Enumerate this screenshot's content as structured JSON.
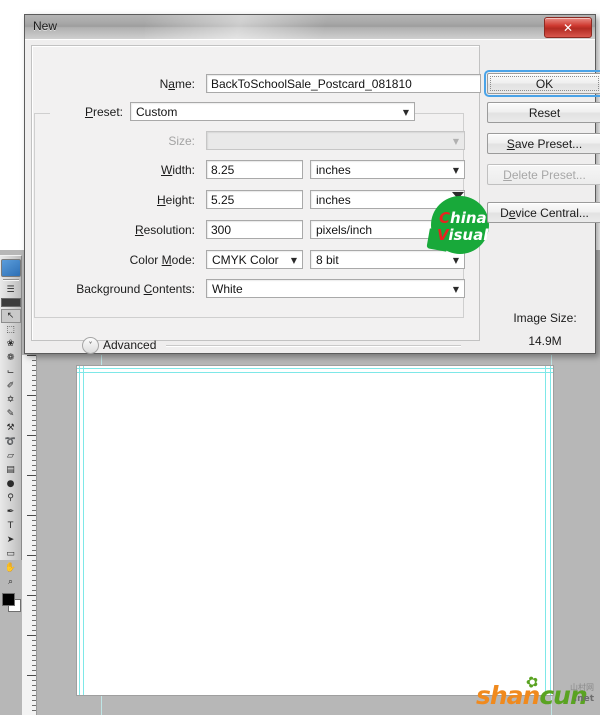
{
  "workspace": {
    "app": "Adobe Photoshop",
    "toolbar": {
      "tools": [
        {
          "name": "move-tool",
          "glyph": "↖"
        },
        {
          "name": "marquee-tool",
          "glyph": "⬚"
        },
        {
          "name": "lasso-tool",
          "glyph": "❀"
        },
        {
          "name": "quick-select-tool",
          "glyph": "❁"
        },
        {
          "name": "crop-tool",
          "glyph": "⌙"
        },
        {
          "name": "eyedropper-tool",
          "glyph": "✐"
        },
        {
          "name": "healing-brush-tool",
          "glyph": "✡"
        },
        {
          "name": "brush-tool",
          "glyph": "✎"
        },
        {
          "name": "clone-stamp-tool",
          "glyph": "⚒"
        },
        {
          "name": "history-brush-tool",
          "glyph": "➰"
        },
        {
          "name": "eraser-tool",
          "glyph": "▱"
        },
        {
          "name": "gradient-tool",
          "glyph": "▤"
        },
        {
          "name": "blur-tool",
          "glyph": "●"
        },
        {
          "name": "dodge-tool",
          "glyph": "⚲"
        },
        {
          "name": "pen-tool",
          "glyph": "✒"
        },
        {
          "name": "type-tool",
          "glyph": "T"
        },
        {
          "name": "path-selection-tool",
          "glyph": "➤"
        },
        {
          "name": "shape-tool",
          "glyph": "▭"
        },
        {
          "name": "hand-tool",
          "glyph": "✋"
        },
        {
          "name": "zoom-tool",
          "glyph": "⌕"
        }
      ],
      "foreground_color": "#000000",
      "background_color": "#ffffff"
    },
    "canvas": {
      "background": "#ffffff",
      "guide_color": "#7ee8e8",
      "workspace_color": "#b7b7b7"
    }
  },
  "watermark_corner": {
    "brand_part1": "shan",
    "brand_part2": "cun",
    "cn_text": "山村网",
    "tld": ".net",
    "color1": "#f08a1e",
    "color2": "#5aa322"
  },
  "watermark_logo": {
    "line1_cap": "C",
    "line1_rest": "hina",
    "line2_cap": "V",
    "line2_rest": "isual",
    "bubble_color": "#18a93a",
    "cap_color": "#e8231f"
  },
  "dialog": {
    "title": "New",
    "close_label": "✕",
    "fields": {
      "name": {
        "label_pre": "N",
        "label_u": "a",
        "label_post": "me:",
        "label_full": "Name:",
        "value": "BackToSchoolSale_Postcard_081810"
      },
      "preset": {
        "label_full": "Preset:",
        "label_u": "P",
        "label_post": "reset:",
        "value": "Custom"
      },
      "size": {
        "label_full": "Size:",
        "value": "",
        "disabled": true
      },
      "width": {
        "label_u": "W",
        "label_post": "idth:",
        "label_full": "Width:",
        "value": "8.25",
        "unit": "inches"
      },
      "height": {
        "label_u": "H",
        "label_post": "eight:",
        "label_full": "Height:",
        "value": "5.25",
        "unit": "inches"
      },
      "resolution": {
        "label_u": "R",
        "label_post": "esolution:",
        "label_full": "Resolution:",
        "value": "300",
        "unit": "pixels/inch"
      },
      "color_mode": {
        "label_pre": "Color ",
        "label_u": "M",
        "label_post": "ode:",
        "label_full": "Color Mode:",
        "value": "CMYK Color",
        "depth": "8 bit"
      },
      "background_contents": {
        "label_pre": "Background ",
        "label_u": "C",
        "label_post": "ontents:",
        "label_full": "Background Contents:",
        "value": "White"
      },
      "advanced": {
        "label": "Advanced",
        "chevron": "˅"
      }
    },
    "buttons": [
      {
        "name": "ok-button",
        "label": "OK",
        "state": "focused"
      },
      {
        "name": "reset-button",
        "label": "Reset",
        "state": "normal"
      },
      {
        "name": "save-preset-button",
        "label_u": "S",
        "label_post": "ave Preset...",
        "label": "Save Preset...",
        "state": "normal"
      },
      {
        "name": "delete-preset-button",
        "label_u": "D",
        "label_post": "elete Preset...",
        "label": "Delete Preset...",
        "state": "disabled"
      },
      {
        "name": "device-central-button",
        "label_u": "D",
        "label_post": "evice Central...",
        "label": "Device Central...",
        "state": "normal"
      }
    ],
    "image_size": {
      "label": "Image Size:",
      "value": "14.9M"
    },
    "dropdown_arrow": "▼"
  }
}
